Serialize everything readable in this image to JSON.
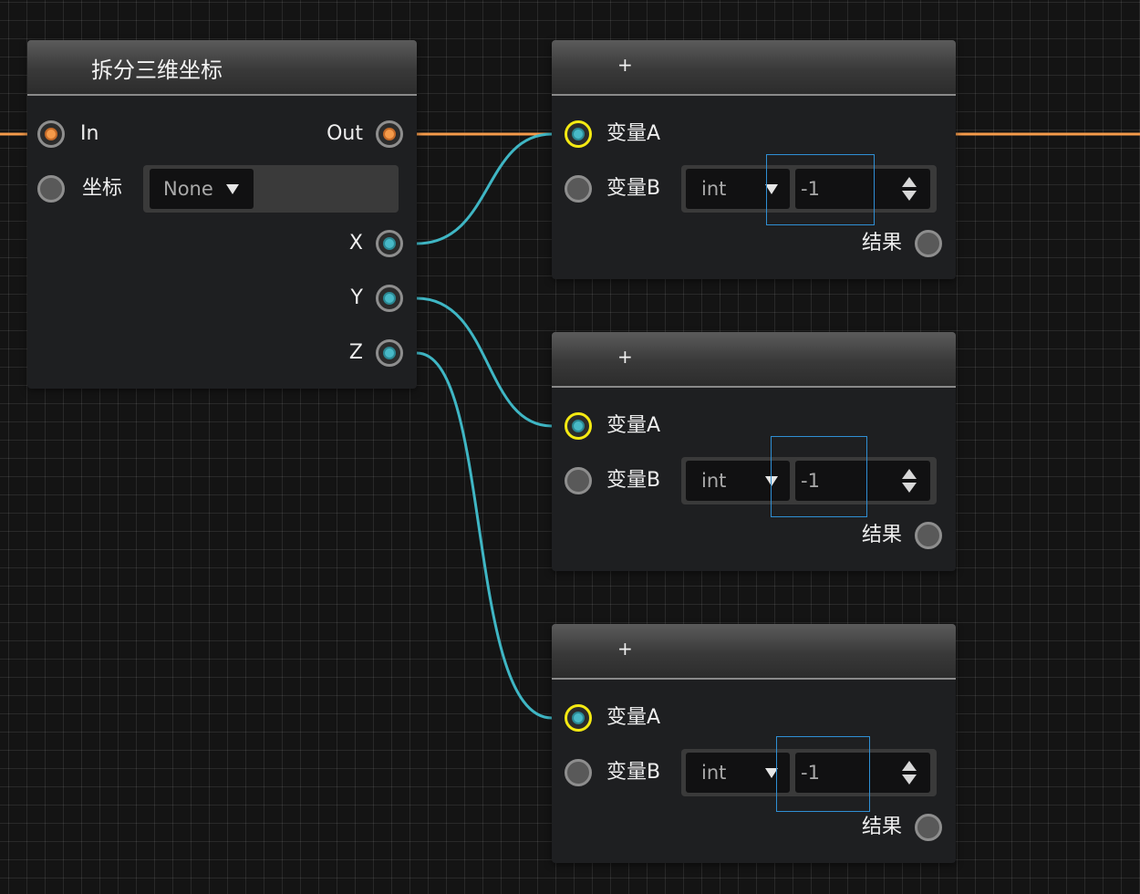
{
  "split_node": {
    "title": "拆分三维坐标",
    "in_label": "In",
    "out_label": "Out",
    "coord_label": "坐标",
    "coord_dropdown_value": "None",
    "x_label": "X",
    "y_label": "Y",
    "z_label": "Z"
  },
  "add_nodes": [
    {
      "title": "+",
      "var_a_label": "变量A",
      "var_b_label": "变量B",
      "type_value": "int",
      "number_value": "-1",
      "result_label": "结果"
    },
    {
      "title": "+",
      "var_a_label": "变量A",
      "var_b_label": "变量B",
      "type_value": "int",
      "number_value": "-1",
      "result_label": "结果"
    },
    {
      "title": "+",
      "var_a_label": "变量A",
      "var_b_label": "变量B",
      "type_value": "int",
      "number_value": "-1",
      "result_label": "结果"
    }
  ],
  "colors": {
    "exec_wire": "#f49a4a",
    "data_wire": "#3fb6c4",
    "selected_port": "#f5ea12",
    "focus_outline": "#2f8fd4"
  }
}
